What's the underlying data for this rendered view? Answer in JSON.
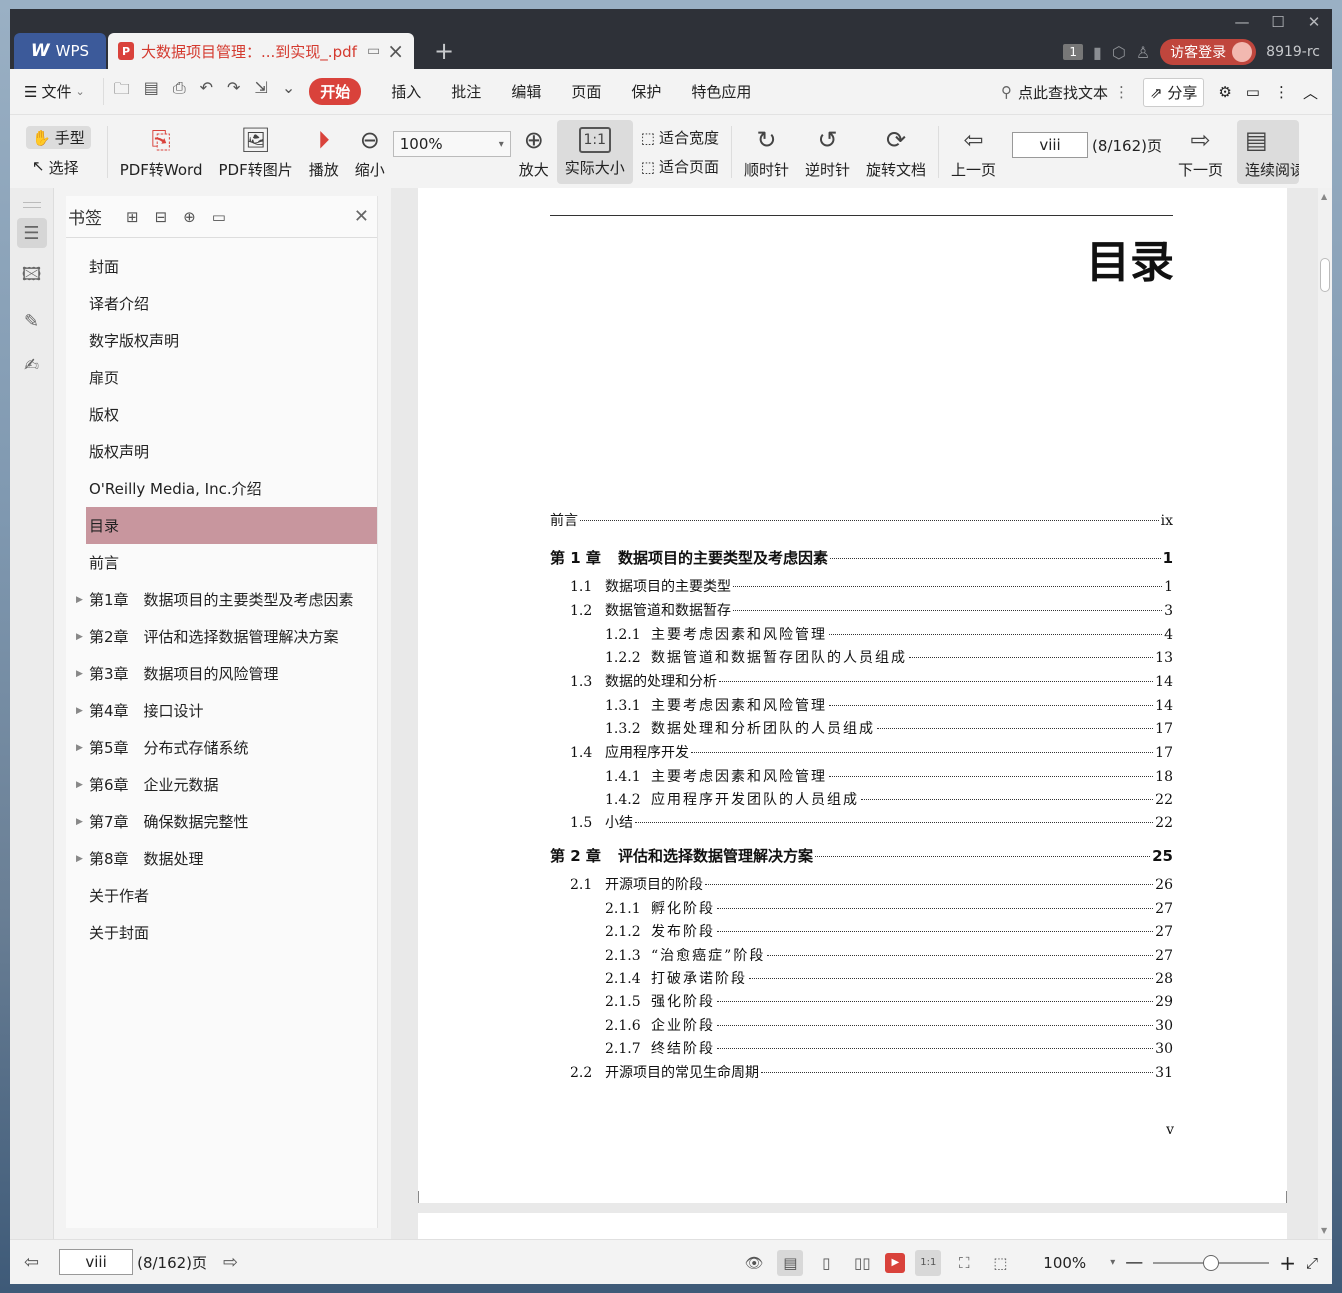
{
  "titlebar": {
    "app_tab": "WPS",
    "doc_tab": "大数据项目管理：...到实现_.pdf",
    "badge": "1",
    "login": "访客登录",
    "user": "8919-rc"
  },
  "menubar": {
    "file": "文件",
    "tabs": [
      "开始",
      "插入",
      "批注",
      "编辑",
      "页面",
      "保护",
      "特色应用"
    ],
    "search": "点此查找文本",
    "share": "分享"
  },
  "toolbar": {
    "hand": "手型",
    "select": "选择",
    "pdf_word": "PDF转Word",
    "pdf_image": "PDF转图片",
    "play": "播放",
    "zoom_out": "缩小",
    "zoom_value": "100%",
    "zoom_in": "放大",
    "actual_size": "实际大小",
    "fit_width": "适合宽度",
    "fit_page": "适合页面",
    "clockwise": "顺时针",
    "counter_clockwise": "逆时针",
    "rotate_doc": "旋转文档",
    "prev_page": "上一页",
    "page_value": "viii",
    "page_count": "(8/162)页",
    "next_page": "下一页",
    "continuous": "连续阅读"
  },
  "bookmarks": {
    "title": "书签",
    "items": [
      {
        "label": "封面",
        "arrow": false
      },
      {
        "label": "译者介绍",
        "arrow": false
      },
      {
        "label": "数字版权声明",
        "arrow": false
      },
      {
        "label": "扉页",
        "arrow": false
      },
      {
        "label": "版权",
        "arrow": false
      },
      {
        "label": "版权声明",
        "arrow": false
      },
      {
        "label": "O'Reilly Media, Inc.介绍",
        "arrow": false
      },
      {
        "label": "目录",
        "arrow": false,
        "selected": true
      },
      {
        "label": "前言",
        "arrow": false
      },
      {
        "label": "第1章　数据项目的主要类型及考虑因素",
        "arrow": true
      },
      {
        "label": "第2章　评估和选择数据管理解决方案",
        "arrow": true
      },
      {
        "label": "第3章　数据项目的风险管理",
        "arrow": true
      },
      {
        "label": "第4章　接口设计",
        "arrow": true
      },
      {
        "label": "第5章　分布式存储系统",
        "arrow": true
      },
      {
        "label": "第6章　企业元数据",
        "arrow": true
      },
      {
        "label": "第7章　确保数据完整性",
        "arrow": true
      },
      {
        "label": "第8章　数据处理",
        "arrow": true
      },
      {
        "label": "关于作者",
        "arrow": false
      },
      {
        "label": "关于封面",
        "arrow": false
      }
    ]
  },
  "document": {
    "title": "目录",
    "toc": [
      {
        "level": 0,
        "num": "",
        "text": "前言",
        "page": "ix"
      },
      {
        "level": -1,
        "num": "第 1 章",
        "text": "数据项目的主要类型及考虑因素",
        "page": "1"
      },
      {
        "level": 1,
        "num": "1.1",
        "text": "数据项目的主要类型",
        "page": "1"
      },
      {
        "level": 1,
        "num": "1.2",
        "text": "数据管道和数据暂存",
        "page": "3"
      },
      {
        "level": 2,
        "num": "1.2.1",
        "text": "主要考虑因素和风险管理",
        "page": "4"
      },
      {
        "level": 2,
        "num": "1.2.2",
        "text": "数据管道和数据暂存团队的人员组成",
        "page": "13"
      },
      {
        "level": 1,
        "num": "1.3",
        "text": "数据的处理和分析",
        "page": "14"
      },
      {
        "level": 2,
        "num": "1.3.1",
        "text": "主要考虑因素和风险管理",
        "page": "14"
      },
      {
        "level": 2,
        "num": "1.3.2",
        "text": "数据处理和分析团队的人员组成",
        "page": "17"
      },
      {
        "level": 1,
        "num": "1.4",
        "text": "应用程序开发",
        "page": "17"
      },
      {
        "level": 2,
        "num": "1.4.1",
        "text": "主要考虑因素和风险管理",
        "page": "18"
      },
      {
        "level": 2,
        "num": "1.4.2",
        "text": "应用程序开发团队的人员组成",
        "page": "22"
      },
      {
        "level": 1,
        "num": "1.5",
        "text": "小结",
        "page": "22"
      },
      {
        "level": -1,
        "num": "第 2 章",
        "text": "评估和选择数据管理解决方案",
        "page": "25"
      },
      {
        "level": 1,
        "num": "2.1",
        "text": "开源项目的阶段",
        "page": "26"
      },
      {
        "level": 2,
        "num": "2.1.1",
        "text": "孵化阶段",
        "page": "27"
      },
      {
        "level": 2,
        "num": "2.1.2",
        "text": "发布阶段",
        "page": "27"
      },
      {
        "level": 2,
        "num": "2.1.3",
        "text": "“治愈癌症”阶段",
        "page": "27"
      },
      {
        "level": 2,
        "num": "2.1.4",
        "text": "打破承诺阶段",
        "page": "28"
      },
      {
        "level": 2,
        "num": "2.1.5",
        "text": "强化阶段",
        "page": "29"
      },
      {
        "level": 2,
        "num": "2.1.6",
        "text": "企业阶段",
        "page": "30"
      },
      {
        "level": 2,
        "num": "2.1.7",
        "text": "终结阶段",
        "page": "30"
      },
      {
        "level": 1,
        "num": "2.2",
        "text": "开源项目的常见生命周期",
        "page": "31"
      }
    ],
    "page_number": "v"
  },
  "statusbar": {
    "page_value": "viii",
    "page_count": "(8/162)页",
    "zoom": "100%"
  }
}
